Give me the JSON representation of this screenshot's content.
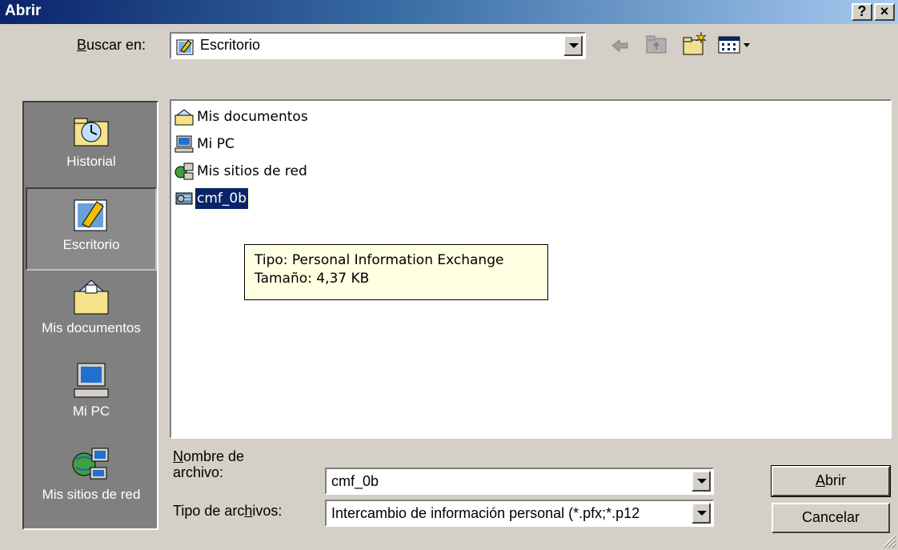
{
  "window": {
    "title": "Abrir",
    "help_label": "?",
    "close_label": "×"
  },
  "lookin": {
    "label_prefix": "",
    "label_u": "B",
    "label_rest": "uscar en:",
    "value": "Escritorio"
  },
  "places": [
    {
      "label": "Historial",
      "icon": "history-icon"
    },
    {
      "label": "Escritorio",
      "icon": "desktop-icon",
      "selected": true
    },
    {
      "label": "Mis documentos",
      "icon": "my-documents-icon"
    },
    {
      "label": "Mi PC",
      "icon": "my-computer-icon"
    },
    {
      "label": "Mis sitios de red",
      "icon": "network-places-icon"
    }
  ],
  "files": [
    {
      "label": "Mis documentos",
      "icon": "my-documents-icon"
    },
    {
      "label": "Mi PC",
      "icon": "my-computer-icon"
    },
    {
      "label": "Mis sitios de red",
      "icon": "network-places-icon"
    },
    {
      "label": "cmf_0b",
      "icon": "certificate-icon",
      "selected": true
    }
  ],
  "tooltip": {
    "line1": "Tipo: Personal Information Exchange",
    "line2": "Tamaño: 4,37 KB"
  },
  "filename": {
    "label_u": "N",
    "label_line1_rest": "ombre de",
    "label_line2": "archivo:",
    "value": "cmf_0b"
  },
  "filetype": {
    "label_pre": "Tipo de arc",
    "label_u": "h",
    "label_post": "ivos:",
    "value": "Intercambio de información personal (*.pfx;*.p12"
  },
  "buttons": {
    "open_u": "A",
    "open_rest": "brir",
    "cancel": "Cancelar"
  },
  "colors": {
    "titlebar_start": "#0a246a",
    "selection": "#0a246a",
    "tooltip_bg": "#ffffe1",
    "face": "#d4d0c8"
  }
}
